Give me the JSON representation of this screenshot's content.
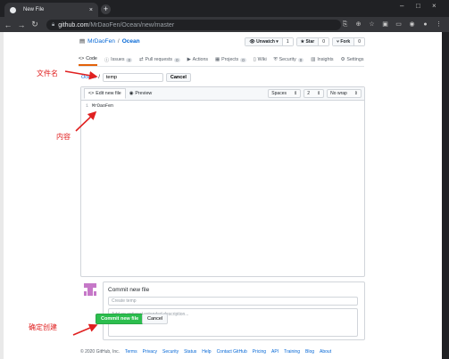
{
  "browser": {
    "tab_title": "New File",
    "new_tab": "+",
    "url_domain": "github.com",
    "url_path": "/MrDaoFen/Ocean/new/master"
  },
  "repo": {
    "owner": "MrDaoFen",
    "sep": "/",
    "name": "Ocean",
    "unwatch_label": "Unwatch",
    "unwatch_count": "1",
    "star_label": "Star",
    "star_count": "0",
    "fork_label": "Fork",
    "fork_count": "0"
  },
  "nav": [
    {
      "label": "Code",
      "icon": "code-icon",
      "count": ""
    },
    {
      "label": "Issues",
      "icon": "issue-icon",
      "count": "0"
    },
    {
      "label": "Pull requests",
      "icon": "pr-icon",
      "count": "0"
    },
    {
      "label": "Actions",
      "icon": "play-icon",
      "count": ""
    },
    {
      "label": "Projects",
      "icon": "project-icon",
      "count": "0"
    },
    {
      "label": "Wiki",
      "icon": "book-icon",
      "count": ""
    },
    {
      "label": "Security",
      "icon": "shield-icon",
      "count": "0"
    },
    {
      "label": "Insights",
      "icon": "graph-icon",
      "count": ""
    },
    {
      "label": "Settings",
      "icon": "gear-icon",
      "count": ""
    }
  ],
  "filepath": {
    "repo_link": "Ocean",
    "sep": "/",
    "filename_value": "temp",
    "cancel_label": "Cancel"
  },
  "editor": {
    "edit_tab": "Edit new file",
    "preview_tab": "Preview",
    "indent_mode": "Spaces",
    "indent_size": "2",
    "wrap_mode": "No wrap",
    "line_number": "1",
    "line_content": "MrDaoFen"
  },
  "commit": {
    "title": "Commit new file",
    "summary_placeholder": "Create temp",
    "desc_placeholder": "Add an optional extended description...",
    "commit_button": "Commit new file",
    "cancel_button": "Cancel"
  },
  "annotations": {
    "filename": "文件名",
    "content": "内容",
    "create": "确定创建"
  },
  "footer": [
    "© 2020 GitHub, Inc.",
    "Terms",
    "Privacy",
    "Security",
    "Status",
    "Help",
    "Contact GitHub",
    "Pricing",
    "API",
    "Training",
    "Blog",
    "About"
  ],
  "colors": {
    "accent_green": "#2cbe4e",
    "link_blue": "#0366d6",
    "annotation_red": "#e02020",
    "tab_underline": "#e36209"
  }
}
